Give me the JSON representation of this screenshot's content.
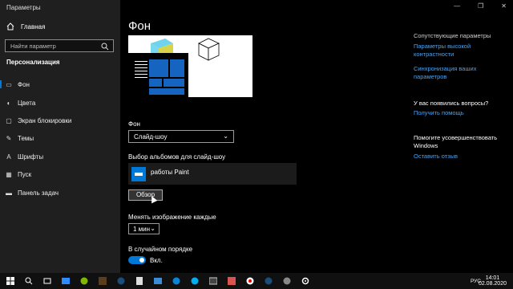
{
  "window": {
    "title": "Параметры",
    "controls": [
      "—",
      "❐",
      "✕"
    ]
  },
  "sidebar": {
    "home_label": "Главная",
    "search_placeholder": "Найти параметр",
    "section_title": "Персонализация",
    "items": [
      {
        "label": "Фон",
        "icon": "image-icon"
      },
      {
        "label": "Цвета",
        "icon": "palette-icon"
      },
      {
        "label": "Экран блокировки",
        "icon": "lock-screen-icon"
      },
      {
        "label": "Темы",
        "icon": "brush-icon"
      },
      {
        "label": "Шрифты",
        "icon": "font-icon"
      },
      {
        "label": "Пуск",
        "icon": "start-icon"
      },
      {
        "label": "Панель задач",
        "icon": "taskbar-icon"
      }
    ],
    "active_index": 0
  },
  "main": {
    "title": "Фон",
    "background_label": "Фон",
    "background_value": "Слайд-шоу",
    "albums_label": "Выбор альбомов для слайд-шоу",
    "album_name": "работы Paint",
    "browse_label": "Обзор",
    "change_label": "Менять изображение каждые",
    "change_value": "1 мин",
    "shuffle_label": "В случайном порядке",
    "shuffle_state": "Вкл."
  },
  "related": {
    "header": "Сопутствующие параметры",
    "links": [
      "Параметры высокой контрастности",
      "Синхронизация ваших параметров"
    ],
    "question": "У вас появились вопросы?",
    "help_link": "Получить помощь",
    "improve_text": "Помогите усовершенствовать Windows",
    "feedback_link": "Оставить отзыв"
  },
  "taskbar": {
    "lang": "РУС",
    "time": "14:01",
    "date": "02.08.2020"
  },
  "colors": {
    "accent": "#0078d7",
    "link": "#4aa3f0"
  }
}
